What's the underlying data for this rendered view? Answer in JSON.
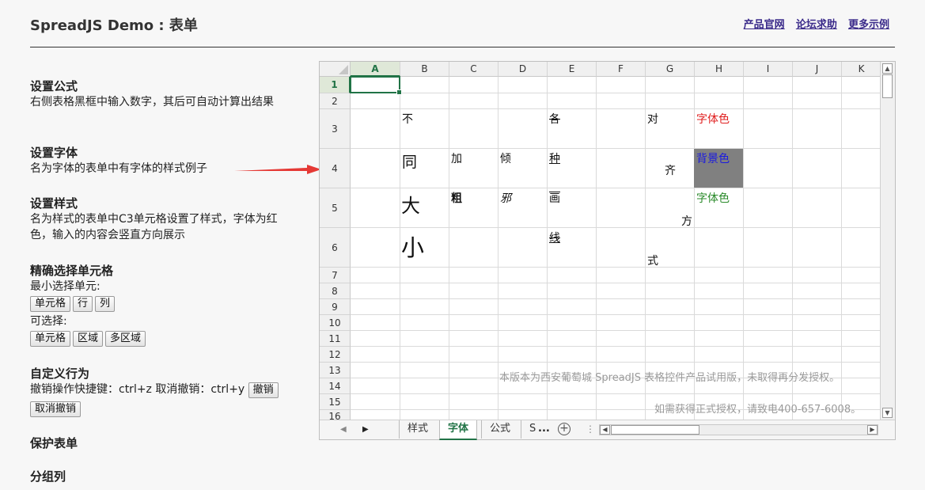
{
  "header": {
    "title": "SpreadJS Demo : 表单",
    "links": [
      "产品官网",
      "论坛求助",
      "更多示例"
    ]
  },
  "sections": {
    "formula": {
      "title": "设置公式",
      "desc": "右侧表格黑框中输入数字，其后可自动计算出结果"
    },
    "font": {
      "title": "设置字体",
      "desc": "名为字体的表单中有字体的样式例子"
    },
    "style": {
      "title": "设置样式",
      "desc": "名为样式的表单中C3单元格设置了样式，字体为红色，输入的内容会竖直方向展示"
    },
    "select": {
      "title": "精确选择单元格",
      "min_label": "最小选择单元:",
      "min_buttons": [
        "单元格",
        "行",
        "列"
      ],
      "opt_label": "可选择:",
      "opt_buttons": [
        "单元格",
        "区域",
        "多区域"
      ]
    },
    "behavior": {
      "title": "自定义行为",
      "desc": "撤销操作快捷键：ctrl+z 取消撤销：ctrl+y",
      "undo": "撤销",
      "redo": "取消撤销"
    },
    "protect": {
      "title": "保护表单"
    },
    "group": {
      "title": "分组列"
    }
  },
  "spreadsheet": {
    "columns": [
      "A",
      "B",
      "C",
      "D",
      "E",
      "F",
      "G",
      "H",
      "I",
      "J",
      "K"
    ],
    "rows": [
      "1",
      "2",
      "3",
      "4",
      "5",
      "6",
      "7",
      "8",
      "9",
      "10",
      "11",
      "12",
      "13",
      "14",
      "15",
      "16"
    ],
    "selected_cell": "A1",
    "cells": {
      "b3": "不",
      "b4": "同",
      "b5": "大",
      "b6": "小",
      "c4": "加",
      "c5": "粗",
      "d4": "倾",
      "d5": "邪",
      "e3": "各",
      "e4": "种",
      "e5": "画",
      "e6": "线",
      "g3": "对",
      "g4": "齐",
      "g5": "方",
      "g6": "式",
      "h3": "字体色",
      "h4": "背景色",
      "h5": "字体色"
    },
    "colors": {
      "h3": "#e02020",
      "h4": "#1a1ae0",
      "h4_bg": "#808080",
      "h5": "#2a8a2a",
      "accent": "#217346"
    },
    "watermark1": "本版本为西安葡萄城 SpreadJS 表格控件产品试用版，未取得再分发授权。",
    "watermark2": "如需获得正式授权，请致电400-657-6008。",
    "tabs": [
      "样式",
      "字体",
      "公式",
      "S"
    ],
    "active_tab": "字体",
    "more": "...",
    "add_tab": "+"
  }
}
